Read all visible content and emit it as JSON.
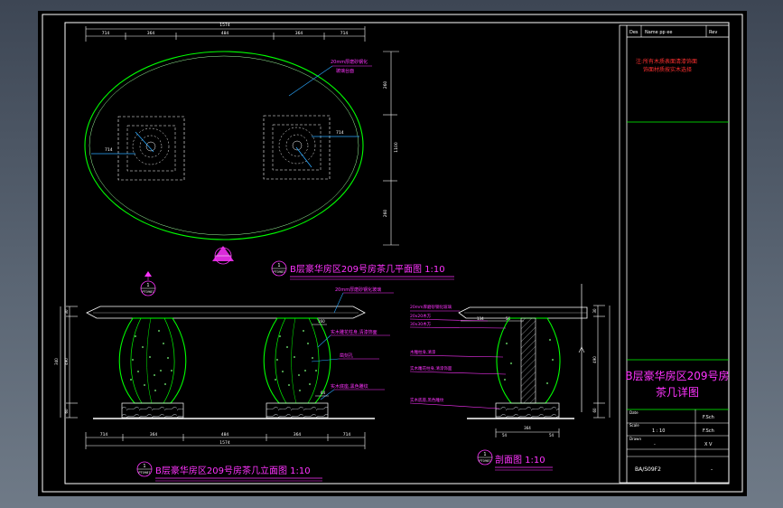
{
  "title_block": {
    "header_cells": [
      "Des",
      "Name pp ee",
      "Rev"
    ],
    "notes": [
      "注:所有木质表面清漆饰面",
      "饰面材质按实木选择"
    ],
    "drawing_name_lines": [
      "B层豪华房区209号房",
      "茶几详图"
    ],
    "rows": [
      {
        "label": "Date",
        "value": "",
        "value2": "F.Sch"
      },
      {
        "label": "Scale",
        "value": "1 : 10",
        "value2": "F.Sch"
      },
      {
        "label": "Drawn",
        "value": "-",
        "value2": "X V"
      }
    ],
    "sheet_no": "BA/S09F2",
    "sheet_suffix": "-"
  },
  "plan_view": {
    "overall_dim": "1574",
    "segment_dims": [
      "714",
      "364",
      "484",
      "364",
      "714"
    ],
    "right_dims": [
      "260",
      "1100",
      "260"
    ],
    "left_offset": "714",
    "right_offset": "714",
    "callout": [
      "20mm厚磨砂钢化",
      "玻璃台面"
    ],
    "caption": "B层豪华房区209号房茶几平面图  1:10",
    "caption_badge": [
      "1",
      "PT0987"
    ]
  },
  "elevation_view": {
    "badge": [
      "1",
      "PT0987"
    ],
    "height_dims": [
      "30",
      "490",
      "60"
    ],
    "left_dims": [
      "340"
    ],
    "callouts": [
      "20mm厚磨砂钢化玻璃",
      "实木雕花柱身,清漆饰面",
      "凿刻孔",
      "实木底座,黑色雕纹"
    ],
    "small_dims": [
      "160",
      "64"
    ],
    "bottom_segments": [
      "714",
      "364",
      "484",
      "364",
      "714"
    ],
    "bottom_overall": "1574",
    "caption": "B层豪华房区209号房茶几立面图  1:10",
    "caption_badge": [
      "1",
      "PT0987"
    ]
  },
  "section_view": {
    "callouts": [
      "20mm厚磨砂钢化玻璃",
      "20x20木方",
      "30x30木方",
      "木雕柱身,清漆",
      "实木雕花柱身,清漆饰面",
      "实木底座,黑色雕纹"
    ],
    "top_dims": [
      "134",
      "50"
    ],
    "bottom_dims": [
      "364",
      "54",
      "54"
    ],
    "right_dims": [
      "30",
      "490",
      "60"
    ],
    "caption": "剖面图  1:10",
    "caption_badge": [
      "1",
      "PT0987"
    ]
  }
}
